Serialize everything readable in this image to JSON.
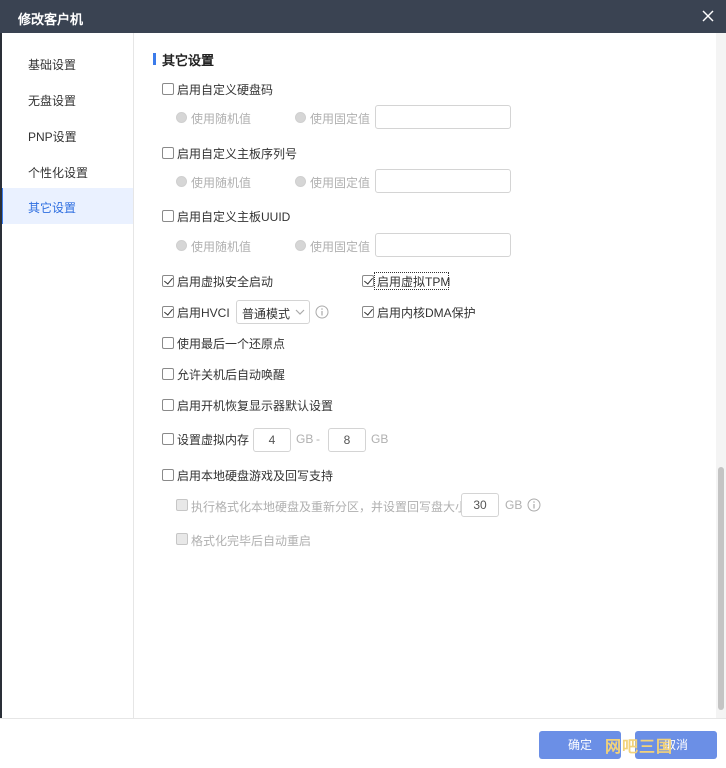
{
  "window": {
    "title": "修改客户机"
  },
  "sidebar": {
    "items": [
      {
        "label": "基础设置"
      },
      {
        "label": "无盘设置"
      },
      {
        "label": "PNP设置"
      },
      {
        "label": "个性化设置"
      },
      {
        "label": "其它设置",
        "active": true
      }
    ]
  },
  "section": {
    "title": "其它设置"
  },
  "options": {
    "custom_disk_code": {
      "label": "启用自定义硬盘码",
      "checked": false,
      "random_label": "使用随机值",
      "fixed_label": "使用固定值",
      "value": ""
    },
    "custom_board_serial": {
      "label": "启用自定义主板序列号",
      "checked": false,
      "random_label": "使用随机值",
      "fixed_label": "使用固定值",
      "value": ""
    },
    "custom_board_uuid": {
      "label": "启用自定义主板UUID",
      "checked": false,
      "random_label": "使用随机值",
      "fixed_label": "使用固定值",
      "value": ""
    },
    "virtual_secure_boot": {
      "label": "启用虚拟安全启动",
      "checked": true
    },
    "virtual_tpm": {
      "label": "启用虚拟TPM",
      "checked": true
    },
    "hvci": {
      "label": "启用HVCI",
      "checked": true,
      "mode": "普通模式"
    },
    "kernel_dma": {
      "label": "启用内核DMA保护",
      "checked": true
    },
    "last_restore_point": {
      "label": "使用最后一个还原点",
      "checked": false
    },
    "wake_after_shutdown": {
      "label": "允许关机后自动唤醒",
      "checked": false
    },
    "restore_display_defaults": {
      "label": "启用开机恢复显示器默认设置",
      "checked": false
    },
    "virtual_memory": {
      "label": "设置虚拟内存",
      "checked": false,
      "min": "4",
      "max": "8",
      "unit": "GB",
      "separator": "-"
    },
    "local_disk_game": {
      "label": "启用本地硬盘游戏及回写支持",
      "checked": false
    },
    "format_local_disk": {
      "label": "执行格式化本地硬盘及重新分区，并设置回写盘大小",
      "checked": false,
      "size": "30",
      "unit": "GB"
    },
    "reboot_after_format": {
      "label": "格式化完毕后自动重启",
      "checked": false
    }
  },
  "footer": {
    "ok_label": "确定",
    "cancel_label": "取消",
    "watermark": "网吧三国"
  },
  "colors": {
    "titlebar": "#3a4352",
    "accent": "#3b7bea",
    "button": "#6b8fe6"
  },
  "scrollbar": {
    "position_fraction": 0.64
  }
}
